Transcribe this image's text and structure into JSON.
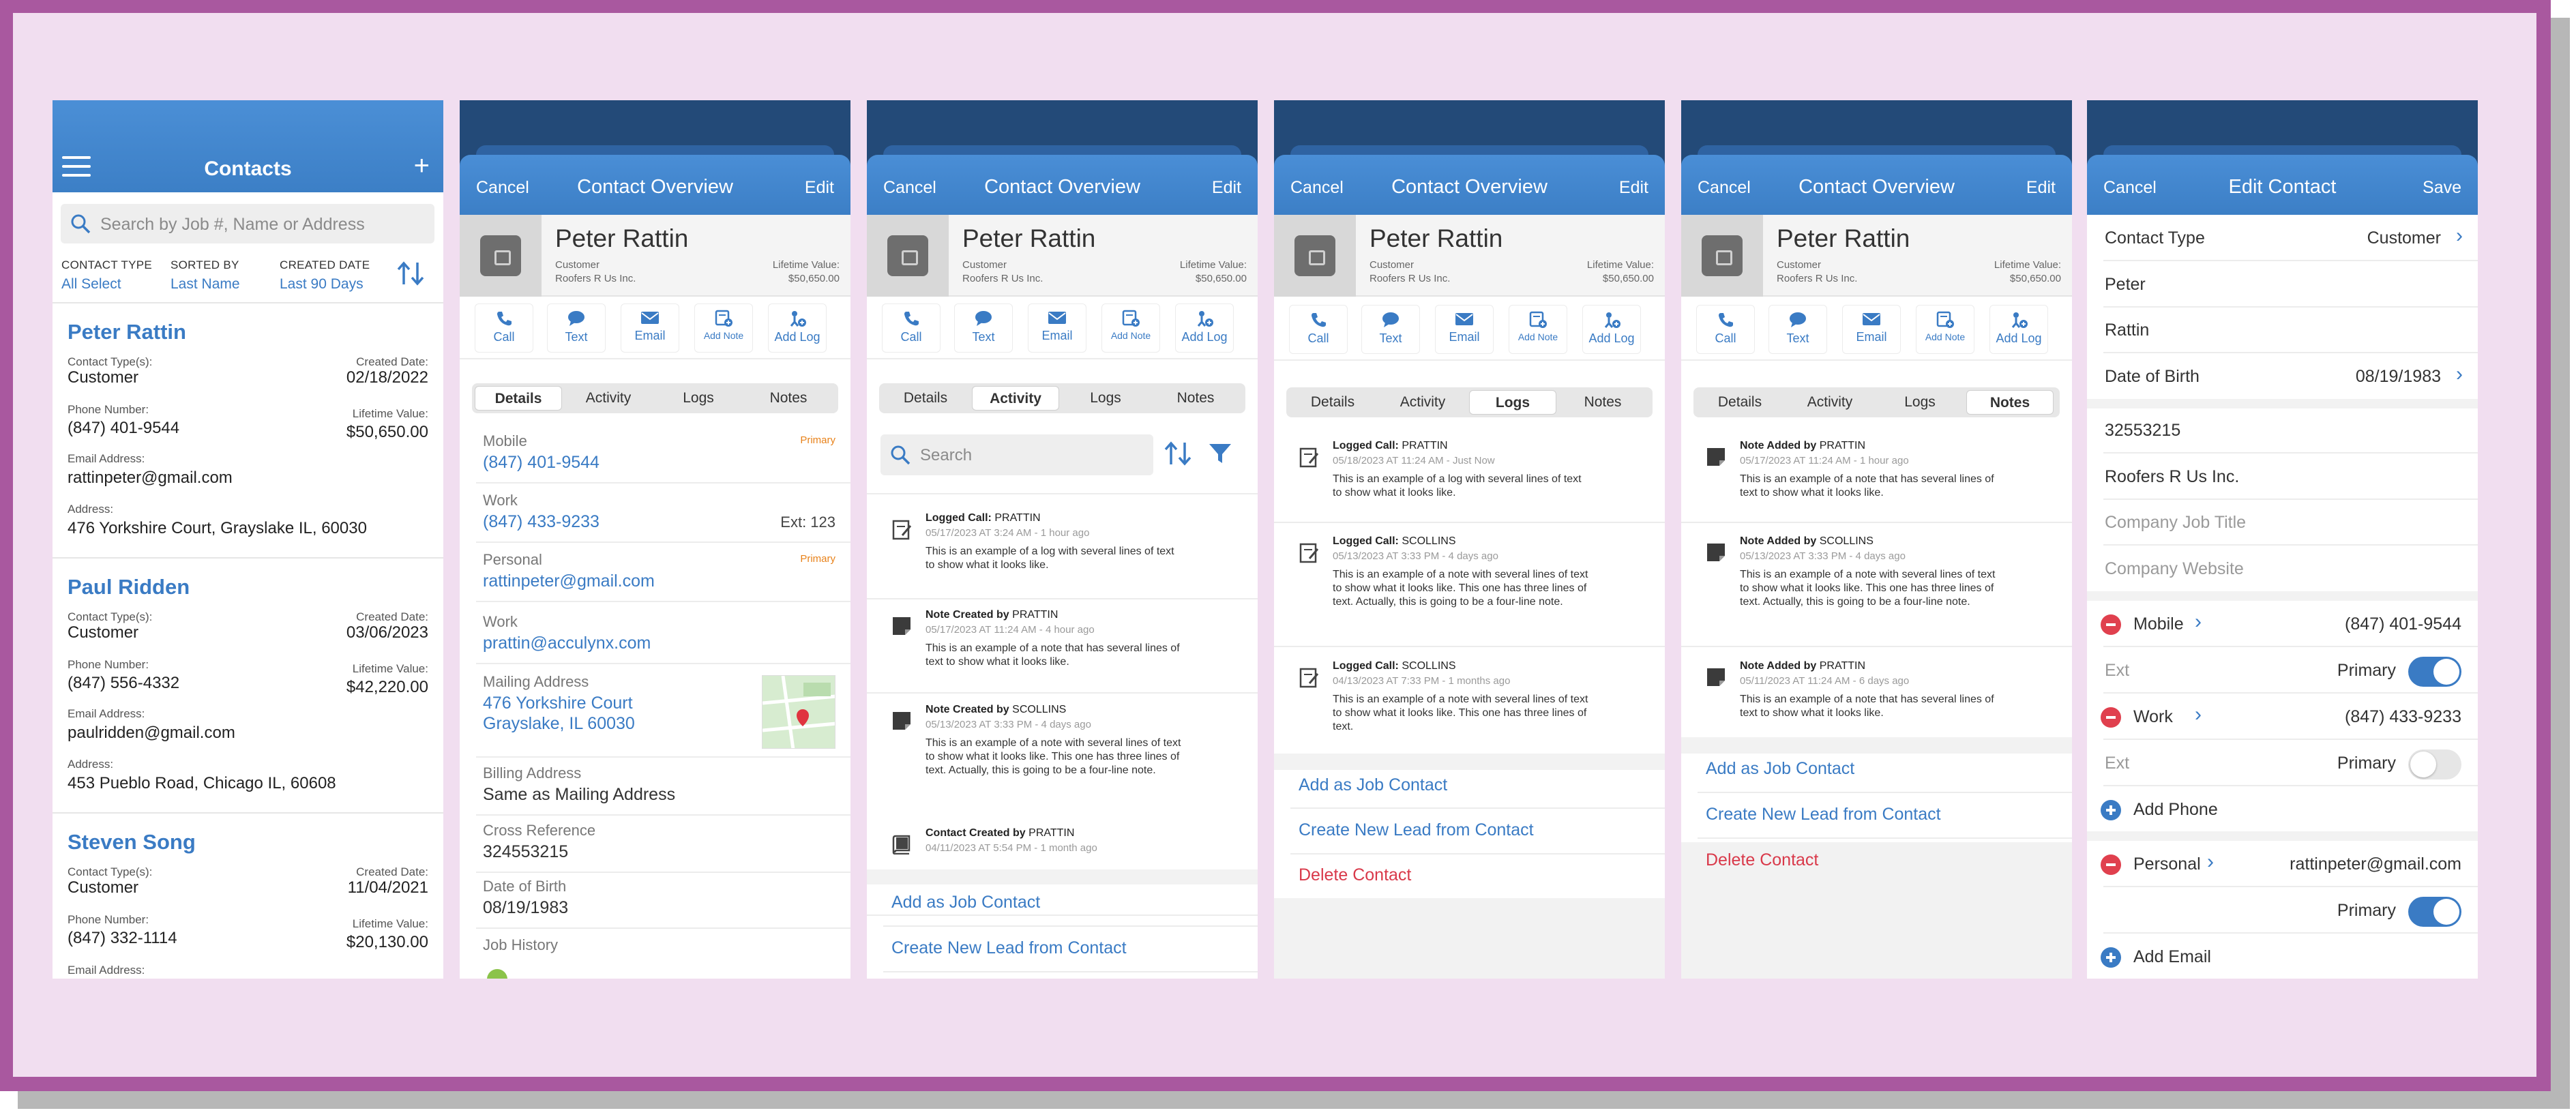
{
  "colors": {
    "accent": "#3a7bc4",
    "header_dark": "#234a78",
    "delete": "#d9394a",
    "primary_badge": "#e8821a",
    "background": "#f1def0",
    "frame": "#a9589f"
  },
  "contacts": {
    "title": "Contacts",
    "search_placeholder": "Search by Job #, Name or Address",
    "filters": [
      {
        "label": "CONTACT TYPE",
        "value": "All Select"
      },
      {
        "label": "SORTED BY",
        "value": "Last Name"
      },
      {
        "label": "CREATED DATE",
        "value": "Last 90 Days"
      }
    ],
    "labels": {
      "types": "Contact Type(s):",
      "created": "Created Date:",
      "phone": "Phone Number:",
      "lifetime": "Lifetime Value:",
      "email": "Email Address:",
      "address": "Address:"
    },
    "list": [
      {
        "name": "Peter Rattin",
        "type": "Customer",
        "created": "02/18/2022",
        "phone": "(847) 401-9544",
        "lifetime": "$50,650.00",
        "email": "rattinpeter@gmail.com",
        "address": "476 Yorkshire Court, Grayslake IL, 60030"
      },
      {
        "name": "Paul Ridden",
        "type": "Customer",
        "created": "03/06/2023",
        "phone": "(847) 556-4332",
        "lifetime": "$42,220.00",
        "email": "paulridden@gmail.com",
        "address": "453 Pueblo Road, Chicago IL, 60608"
      },
      {
        "name": "Steven Song",
        "type": "Customer",
        "created": "11/04/2021",
        "phone": "(847) 332-1114",
        "lifetime": "$20,130.00",
        "email_label": "Email Address:"
      }
    ]
  },
  "overview": {
    "cancel": "Cancel",
    "title": "Contact Overview",
    "edit": "Edit",
    "name": "Peter Rattin",
    "type": "Customer",
    "company": "Roofers R Us Inc.",
    "lifetime_label": "Lifetime Value:",
    "lifetime_value": "$50,650.00",
    "actions": [
      "Call",
      "Text",
      "Email",
      "Add Note",
      "Add Log"
    ],
    "tabs": [
      "Details",
      "Activity",
      "Logs",
      "Notes"
    ]
  },
  "details": {
    "mobile_label": "Mobile",
    "mobile": "(847) 401-9544",
    "primary": "Primary",
    "work_label": "Work",
    "work": "(847) 433-9233",
    "ext": "Ext: 123",
    "personal_label": "Personal",
    "personal_email": "rattinpeter@gmail.com",
    "work_email_label": "Work",
    "work_email": "prattin@acculynx.com",
    "mailing_label": "Mailing Address",
    "mailing_line1": "476 Yorkshire Court",
    "mailing_line2": "Grayslake, IL 60030",
    "billing_label": "Billing Address",
    "billing": "Same as Mailing Address",
    "cross_label": "Cross Reference",
    "cross": "324553215",
    "dob_label": "Date of Birth",
    "dob": "08/19/1983",
    "job_history_label": "Job History"
  },
  "activity": {
    "search_placeholder": "Search",
    "items": [
      {
        "kind": "Logged Call:",
        "who": "PRATTIN",
        "date": "05/17/2023 AT 3:24 AM - 1 hour ago",
        "body": "This is an example of a log with several lines of text to show what it looks like."
      },
      {
        "kind": "Note Created by",
        "who": "PRATTIN",
        "date": "05/17/2023 AT 11:24 AM - 4 hour ago",
        "body": "This is an example of a note that has several lines of text to show what it looks like."
      },
      {
        "kind": "Note Created by",
        "who": "SCOLLINS",
        "date": "05/13/2023 AT 3:33 PM - 4 days ago",
        "body": "This is an example of a note with several lines of text to show what it looks like. This one has three lines of text. Actually, this is going to be a four-line note."
      },
      {
        "kind": "Contact Created by",
        "who": "PRATTIN",
        "date": "04/11/2023 AT 5:54 PM - 1 month ago",
        "body": ""
      }
    ],
    "links": [
      "Add as Job Contact",
      "Create New Lead from Contact"
    ]
  },
  "logs": {
    "items": [
      {
        "kind": "Logged Call:",
        "who": "PRATTIN",
        "date": "05/18/2023 AT 11:24 AM - Just Now",
        "body": "This is an example of a log with several lines of text to show what it looks like."
      },
      {
        "kind": "Logged Call:",
        "who": "SCOLLINS",
        "date": "05/13/2023 AT 3:33 PM - 4 days ago",
        "body": "This is an example of a note with several lines of text to show what it looks like. This one has three lines of text. Actually, this is going to be a four-line note."
      },
      {
        "kind": "Logged Call:",
        "who": "SCOLLINS",
        "date": "04/13/2023 AT 7:33 PM - 1 months ago",
        "body": "This is an example of a note with several lines of text to show what it looks like. This one has three lines of text."
      }
    ],
    "links": [
      "Add as Job Contact",
      "Create New Lead from Contact"
    ],
    "delete": "Delete Contact"
  },
  "notes": {
    "items": [
      {
        "kind": "Note Added by",
        "who": "PRATTIN",
        "date": "05/17/2023 AT 11:24 AM - 1 hour ago",
        "body": "This is an example of a note that has several lines of text to show what it looks like."
      },
      {
        "kind": "Note Added by",
        "who": "SCOLLINS",
        "date": "05/13/2023 AT 3:33 PM - 4 days ago",
        "body": "This is an example of a note with several lines of text to show what it looks like. This one has three lines of text. Actually, this is going to be a four-line note."
      },
      {
        "kind": "Note Added by",
        "who": "PRATTIN",
        "date": "05/11/2023 AT 11:24 AM - 6 days ago",
        "body": "This is an example of a note that has several lines of text to show what it looks like."
      }
    ],
    "links": [
      "Add as Job Contact",
      "Create New Lead from Contact"
    ],
    "delete": "Delete Contact"
  },
  "edit": {
    "cancel": "Cancel",
    "title": "Edit Contact",
    "save": "Save",
    "contact_type_label": "Contact Type",
    "contact_type": "Customer",
    "first": "Peter",
    "last": "Rattin",
    "dob_label": "Date of Birth",
    "dob": "08/19/1983",
    "cross": "32553215",
    "company": "Roofers R Us Inc.",
    "job_title_ph": "Company Job Title",
    "website_ph": "Company Website",
    "mobile_label": "Mobile",
    "mobile": "(847) 401-9544",
    "ext_label": "Ext",
    "primary": "Primary",
    "work_label": "Work",
    "work": "(847) 433-9233",
    "add_phone": "Add Phone",
    "personal_label": "Personal",
    "personal_email": "rattinpeter@gmail.com",
    "add_email": "Add Email"
  }
}
